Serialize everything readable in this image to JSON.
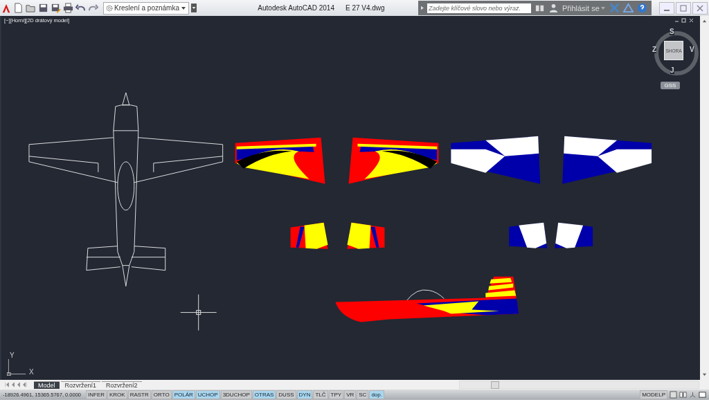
{
  "title_bar": {
    "workspace": "Kreslení a poznámka",
    "app_title": "Autodesk AutoCAD 2014",
    "file_name": "E 27 V4.dwg",
    "search": {
      "placeholder": "Zadejte klíčové slovo nebo výraz."
    },
    "sign_in": "Přihlásit se"
  },
  "viewport": {
    "label": "[−][Horní][2D drátový model]",
    "viewcube": {
      "north": "S",
      "west": "Z",
      "east": "V",
      "south": "J",
      "face": "SHORA",
      "ucs": "GSS"
    },
    "ucs_icon": {
      "y": "Y",
      "x": "X"
    }
  },
  "layout_tabs": [
    {
      "label": "Model",
      "selected": true
    },
    {
      "label": "Rozvržení1",
      "selected": false
    },
    {
      "label": "Rozvržení2",
      "selected": false
    }
  ],
  "status_bar": {
    "coordinates": "-18926.4961, 15365.5767, 0.0000",
    "toggles": [
      {
        "label": "INFER",
        "on": false
      },
      {
        "label": "KROK",
        "on": false
      },
      {
        "label": "RASTR",
        "on": false
      },
      {
        "label": "ORTO",
        "on": false
      },
      {
        "label": "POLÁR",
        "on": true
      },
      {
        "label": "UCHOP",
        "on": true
      },
      {
        "label": "3DUCHOP",
        "on": false
      },
      {
        "label": "OTRAS",
        "on": true
      },
      {
        "label": "DUSS",
        "on": false
      },
      {
        "label": "DYN",
        "on": true
      },
      {
        "label": "TLČ",
        "on": false
      },
      {
        "label": "TPY",
        "on": false
      },
      {
        "label": "VR",
        "on": false
      },
      {
        "label": "SC",
        "on": false
      },
      {
        "label": "dop.",
        "on": true
      }
    ],
    "space": "MODELP"
  }
}
